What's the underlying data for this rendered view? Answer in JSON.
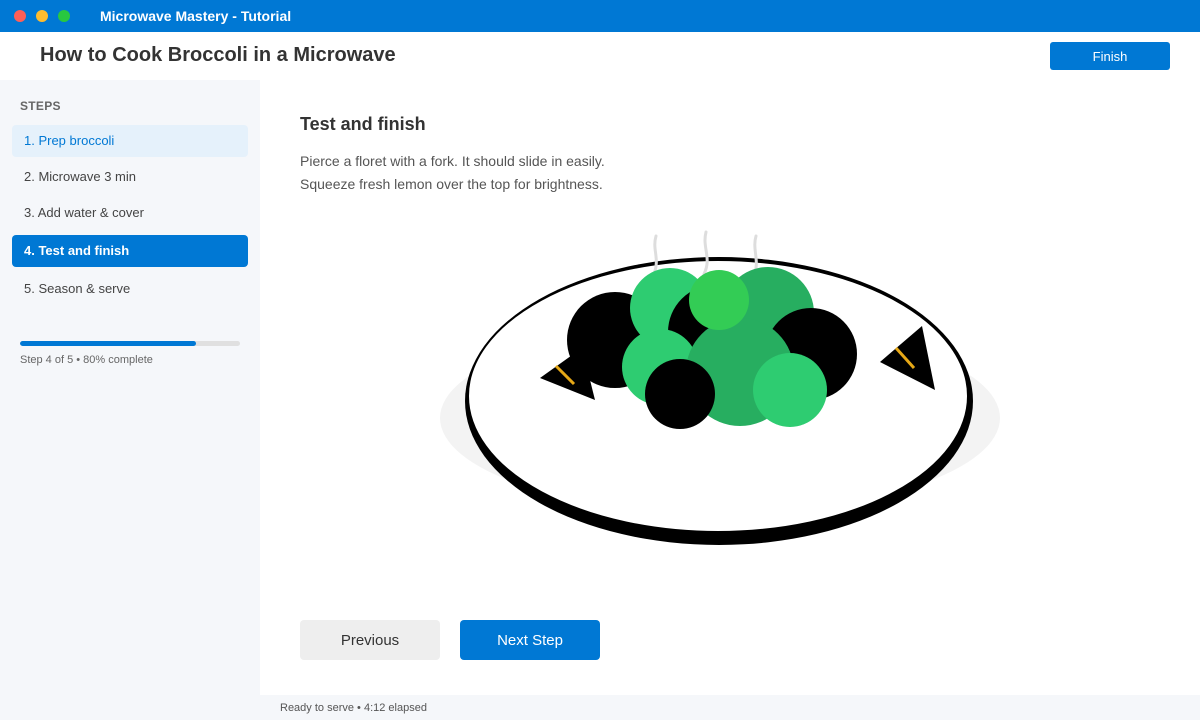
{
  "window": {
    "title": "Microwave Mastery - Tutorial"
  },
  "header": {
    "page_title": "How to Cook Broccoli in a Microwave",
    "finish_label": "Finish"
  },
  "sidebar": {
    "heading": "STEPS",
    "steps": [
      {
        "label": "1. Prep broccoli",
        "state": "visited"
      },
      {
        "label": "2. Microwave 3 min",
        "state": "default"
      },
      {
        "label": "3. Add water & cover",
        "state": "default"
      },
      {
        "label": "4. Test and finish",
        "state": "active"
      },
      {
        "label": "5. Season & serve",
        "state": "default"
      }
    ],
    "progress": {
      "percent": 80,
      "label": "Step 4 of 5 • 80% complete"
    }
  },
  "main": {
    "step_title": "Test and finish",
    "instructions": [
      "Pierce a floret with a fork. It should slide in easily.",
      "Squeeze fresh lemon over the top for brightness."
    ],
    "illustration": {
      "icon": "broccoli-plate-illustration",
      "colors": {
        "floret_light": "#2ecc71",
        "floret_dark": "#27ae60",
        "floret_bright": "#33cc55",
        "lemon_accent": "#e6a817"
      }
    },
    "previous_label": "Previous",
    "next_label": "Next Step"
  },
  "status": {
    "text": "Ready to serve • 4:12 elapsed"
  },
  "colors": {
    "accent": "#0078d4",
    "sidebar_bg": "#f5f7fa",
    "visited_bg": "#e5f1fb"
  }
}
